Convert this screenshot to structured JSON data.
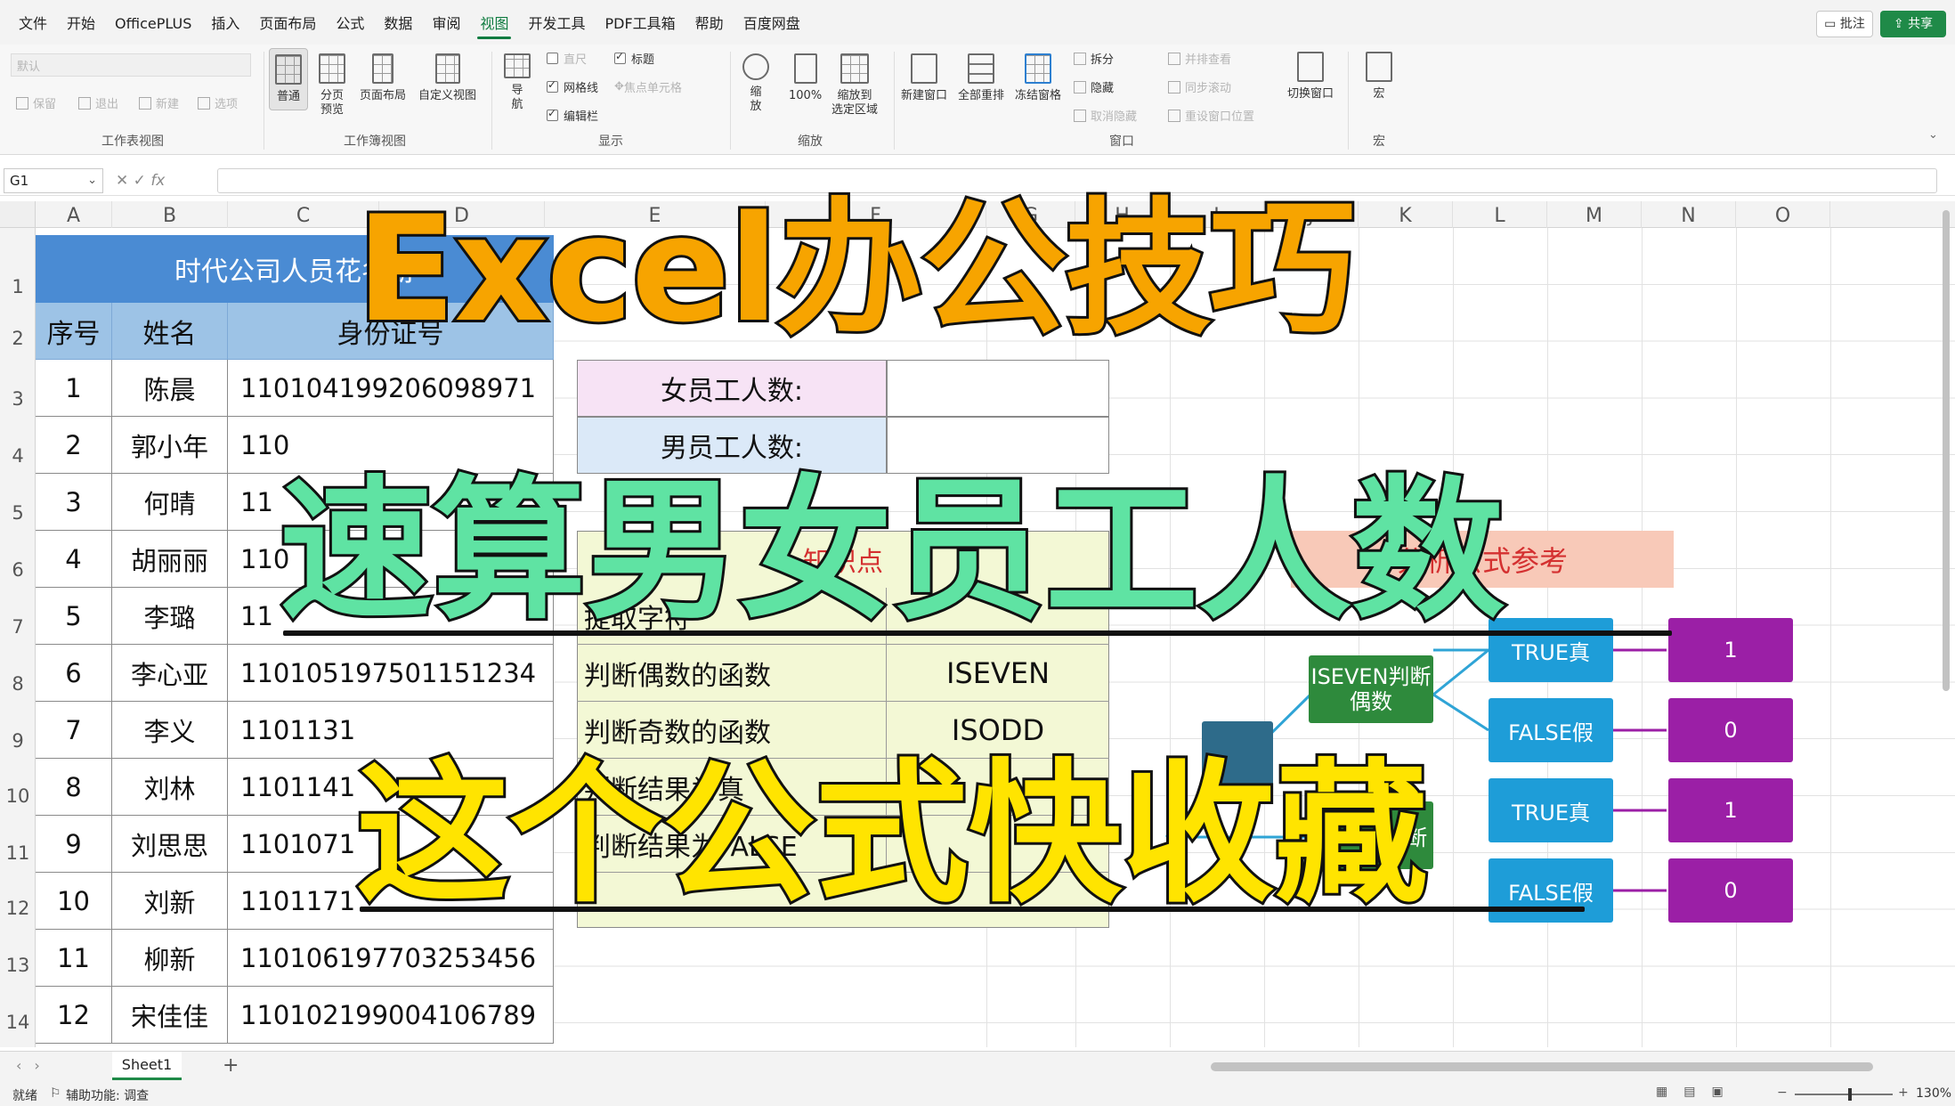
{
  "menu": {
    "items": [
      "文件",
      "开始",
      "OfficePLUS",
      "插入",
      "页面布局",
      "公式",
      "数据",
      "审阅",
      "视图",
      "开发工具",
      "PDF工具箱",
      "帮助",
      "百度网盘"
    ],
    "active_index": 8,
    "comment_label": "批注",
    "share_label": "共享"
  },
  "ribbon": {
    "sheet_view_dropdown": "默认",
    "sheet_view_actions": [
      "保留",
      "退出",
      "新建",
      "选项"
    ],
    "group_sheet_view": "工作表视图",
    "btn_normal": "普通",
    "btn_pagebreak": "分页\n预览",
    "btn_pagelayout": "页面布局",
    "btn_custom": "自定义视图",
    "group_workbook_view": "工作簿视图",
    "btn_nav": "导\n航",
    "show_ruler": "直尺",
    "show_title": "标题",
    "show_gridlines": "网格线",
    "show_focus": "焦点单元格",
    "show_formulabar": "编辑栏",
    "group_show": "显示",
    "btn_zoom": "缩\n放",
    "btn_100": "100%",
    "btn_zoomsel": "缩放到\n选定区域",
    "group_zoom": "缩放",
    "btn_newwin": "新建窗口",
    "btn_arrange": "全部重排",
    "btn_freeze": "冻结窗格",
    "win_split": "拆分",
    "win_hide": "隐藏",
    "win_unhide": "取消隐藏",
    "win_side": "并排查看",
    "win_sync": "同步滚动",
    "win_reset": "重设窗口位置",
    "group_window": "窗口",
    "btn_switch": "切换窗口",
    "btn_macro": "宏",
    "group_macro": "宏"
  },
  "formula_bar": {
    "name_box": "G1",
    "fx": "fx",
    "value": ""
  },
  "columns": [
    "A",
    "B",
    "C",
    "D",
    "E",
    "F",
    "G",
    "H",
    "I",
    "J",
    "K",
    "L",
    "M",
    "N",
    "O"
  ],
  "rows": [
    "1",
    "2",
    "3",
    "4",
    "5",
    "6",
    "7",
    "8",
    "9",
    "10",
    "11",
    "12",
    "13",
    "14"
  ],
  "sheet": {
    "title": "时代公司人员花名册",
    "headers": [
      "序号",
      "姓名",
      "身份证号"
    ],
    "records": [
      [
        "1",
        "陈晨",
        "110104199206098971"
      ],
      [
        "2",
        "郭小年",
        "110"
      ],
      [
        "3",
        "何晴",
        "11"
      ],
      [
        "4",
        "胡丽丽",
        "110"
      ],
      [
        "5",
        "李璐",
        "11"
      ],
      [
        "6",
        "李心亚",
        "110105197501151234"
      ],
      [
        "7",
        "李义",
        "1101131"
      ],
      [
        "8",
        "刘林",
        "1101141"
      ],
      [
        "9",
        "刘思思",
        "1101071"
      ],
      [
        "10",
        "刘新",
        "1101171"
      ],
      [
        "11",
        "柳新",
        "110106197703253456"
      ],
      [
        "12",
        "宋佳佳",
        "110102199004106789"
      ]
    ],
    "female_label": "女员工人数:",
    "male_label": "男员工人数:",
    "knowledge_label": "知识点",
    "knowledge_rows": [
      [
        "提取字符",
        ""
      ],
      [
        "判断偶数的函数",
        "ISEVEN"
      ],
      [
        "判断奇数的函数",
        "ISODD"
      ],
      [
        "判断结果为真",
        ""
      ],
      [
        "判断结果为FALSE",
        ""
      ]
    ],
    "ref_label": "分析公式参考",
    "iseven_box": "ISEVEN判断偶数",
    "isodd_box": "ISODD判断",
    "true_box": "TRUE真",
    "false_box": "FALSE假",
    "results": [
      "1",
      "0",
      "1",
      "0"
    ]
  },
  "overlay": {
    "line1": "Excel办公技巧",
    "line2": "速算男女员工人数",
    "line3": "这个公式快收藏"
  },
  "sheet_tab": "Sheet1",
  "status": {
    "ready": "就绪",
    "accessibility": "辅助功能: 调查",
    "zoom": "130%"
  }
}
